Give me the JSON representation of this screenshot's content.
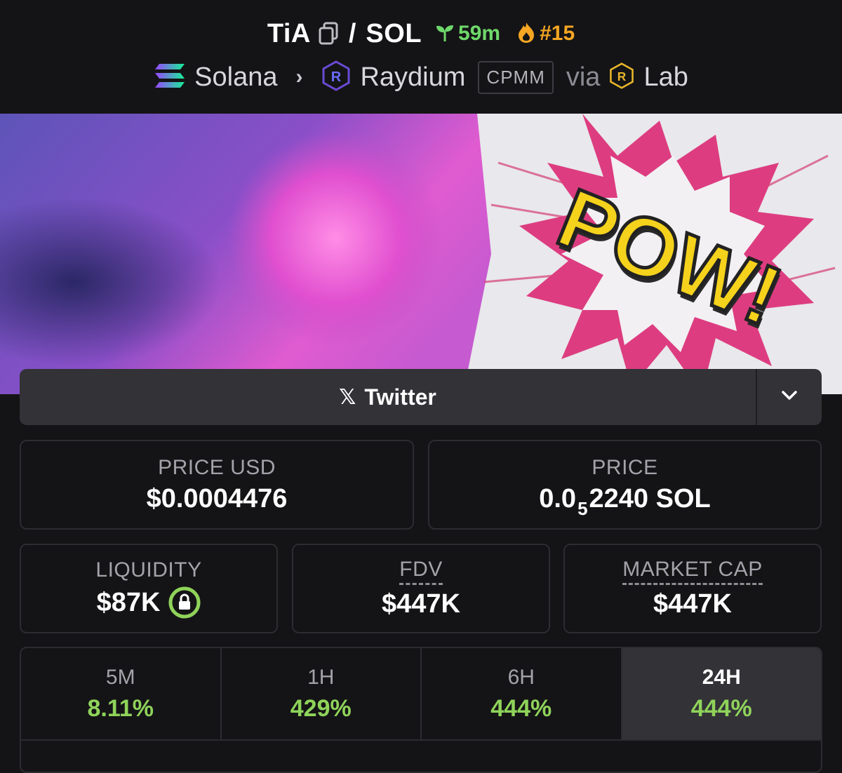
{
  "header": {
    "base_token": "TiA",
    "separator": "/",
    "quote_token": "SOL",
    "age": "59m",
    "trending_rank": "#15",
    "icons": [
      "copy-icon",
      "seedling-icon",
      "flame-icon",
      "solana-logo-icon",
      "raydium-logo-icon",
      "raydium-lab-logo-icon"
    ]
  },
  "breadcrumb": {
    "chain": "Solana",
    "dex": "Raydium",
    "pool_type": "CPMM",
    "via": "via",
    "launchpad": "Lab"
  },
  "banner": {
    "text": "POW!",
    "colors": {
      "magenta": "#e0449a",
      "yellow": "#f5d21c",
      "purple": "#6a4bd6"
    }
  },
  "social": {
    "twitter_label": "Twitter",
    "x_glyph": "𝕏",
    "more_icon": "chevron-down-icon"
  },
  "stats": {
    "price_usd": {
      "label": "PRICE USD",
      "value": "$0.0004476"
    },
    "price": {
      "label": "PRICE",
      "value_prefix": "0.0",
      "value_subscript": "5",
      "value_suffix": "2240 SOL"
    },
    "liquidity": {
      "label": "LIQUIDITY",
      "value": "$87K",
      "locked_icon": "lock-icon"
    },
    "fdv": {
      "label": "FDV",
      "value": "$447K"
    },
    "market_cap": {
      "label": "MARKET CAP",
      "value": "$447K"
    }
  },
  "timeframes": [
    {
      "label": "5M",
      "change": "8.11%"
    },
    {
      "label": "1H",
      "change": "429%"
    },
    {
      "label": "6H",
      "change": "444%"
    },
    {
      "label": "24H",
      "change": "444%",
      "active": true
    }
  ],
  "colors": {
    "background": "#141416",
    "positive": "#8fd35a",
    "age_green": "#6fd86a",
    "rank_orange": "#f6a623",
    "panel": "#323237"
  }
}
